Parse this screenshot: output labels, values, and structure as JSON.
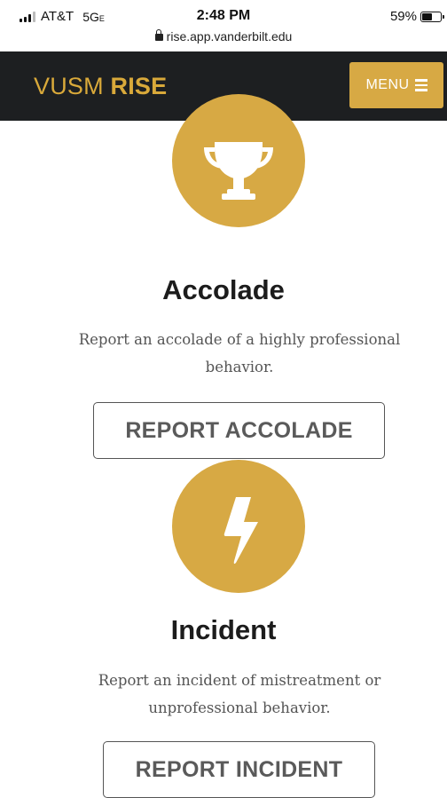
{
  "status_bar": {
    "carrier": "AT&T",
    "network": "5G",
    "network_suffix": "E",
    "time": "2:48 PM",
    "url": "rise.app.vanderbilt.edu",
    "battery": "59%",
    "battery_level": 0.59
  },
  "header": {
    "brand_prefix": "VUSM ",
    "brand_suffix": "RISE",
    "menu_label": "MENU",
    "accent_color": "#d7a944",
    "background_color": "#1d1f21"
  },
  "cards": [
    {
      "icon": "trophy-icon",
      "title": "Accolade",
      "description": "Report an accolade of a highly professional behavior.",
      "button_label": "REPORT ACCOLADE"
    },
    {
      "icon": "lightning-bolt-icon",
      "title": "Incident",
      "description": "Report an incident of mistreatment or unprofessional behavior.",
      "button_label": "REPORT INCIDENT"
    }
  ]
}
